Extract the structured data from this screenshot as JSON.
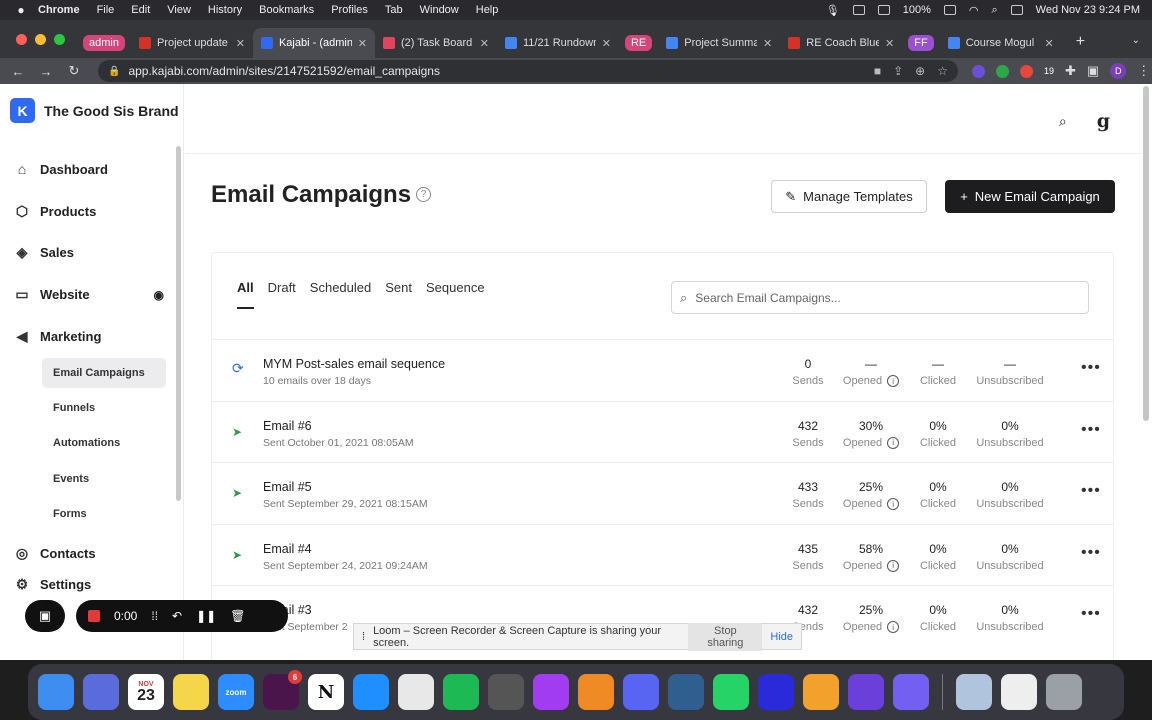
{
  "menubar": {
    "items": [
      "Chrome",
      "File",
      "Edit",
      "View",
      "History",
      "Bookmarks",
      "Profiles",
      "Tab",
      "Window",
      "Help"
    ],
    "battery": "100%",
    "datetime": "Wed Nov 23  9:24 PM"
  },
  "tabs": [
    {
      "label": "admin",
      "kind": "group",
      "color": "#d6457a"
    },
    {
      "label": "Project update",
      "color": "#d93025"
    },
    {
      "label": "Kajabi - (admin)",
      "active": true,
      "color": "#2e6af3"
    },
    {
      "label": "(2) Task Board",
      "color": "#e2445c"
    },
    {
      "label": "11/21 Rundown",
      "color": "#4285f4"
    },
    {
      "label": "RE",
      "kind": "group",
      "color": "#d6457a"
    },
    {
      "label": "Project Summa",
      "color": "#4285f4"
    },
    {
      "label": "RE Coach Blue",
      "color": "#d93025"
    },
    {
      "label": "FF",
      "kind": "group",
      "color": "#9b4fd1"
    },
    {
      "label": "Course Mogul",
      "color": "#4285f4"
    }
  ],
  "address": {
    "url": "app.kajabi.com/admin/sites/2147521592/email_campaigns",
    "profile": "D",
    "ext_badge": "19"
  },
  "brand": {
    "name": "The Good Sis Brand",
    "logo": "K"
  },
  "sidebar": {
    "items": [
      {
        "label": "Dashboard",
        "icon": "home-icon"
      },
      {
        "label": "Products",
        "icon": "box-icon"
      },
      {
        "label": "Sales",
        "icon": "tag-icon"
      },
      {
        "label": "Website",
        "icon": "monitor-icon"
      },
      {
        "label": "Marketing",
        "icon": "megaphone-icon"
      }
    ],
    "sub": [
      "Email Campaigns",
      "Funnels",
      "Automations",
      "Events",
      "Forms"
    ],
    "bottom": [
      {
        "label": "Contacts",
        "icon": "contacts-icon"
      },
      {
        "label": "Settings",
        "icon": "gear-icon"
      }
    ]
  },
  "header": {
    "avatar_letter": "g"
  },
  "main": {
    "title": "Email Campaigns",
    "manage_label": "Manage Templates",
    "new_label": "New Email Campaign",
    "filter_tabs": [
      "All",
      "Draft",
      "Scheduled",
      "Sent",
      "Sequence"
    ],
    "search_placeholder": "Search Email Campaigns...",
    "stat_labels": {
      "sends": "Sends",
      "opened": "Opened",
      "clicked": "Clicked",
      "unsub": "Unsubscribed"
    },
    "rows": [
      {
        "name": "MYM Post-sales email sequence",
        "sub": "10 emails over 18 days",
        "type": "sequence",
        "sends": "0",
        "opened": "—",
        "clicked": "—",
        "unsub": "—"
      },
      {
        "name": "Email #6",
        "sub": "Sent October 01, 2021 08:05AM",
        "type": "sent",
        "sends": "432",
        "opened": "30%",
        "clicked": "0%",
        "unsub": "0%"
      },
      {
        "name": "Email #5",
        "sub": "Sent September 29, 2021 08:15AM",
        "type": "sent",
        "sends": "433",
        "opened": "25%",
        "clicked": "0%",
        "unsub": "0%"
      },
      {
        "name": "Email #4",
        "sub": "Sent September 24, 2021 09:24AM",
        "type": "sent",
        "sends": "435",
        "opened": "58%",
        "clicked": "0%",
        "unsub": "0%"
      },
      {
        "name": "Email #3",
        "sub": "Sent September 2",
        "type": "sent",
        "sends": "432",
        "opened": "25%",
        "clicked": "0%",
        "unsub": "0%"
      }
    ]
  },
  "loom": {
    "timer": "0:00",
    "share_text": "Loom – Screen Recorder & Screen Capture is sharing your screen.",
    "stop_label": "Stop sharing",
    "hide_label": "Hide"
  },
  "dock": {
    "calendar_month": "NOV",
    "calendar_day": "23",
    "zoom_label": "zoom",
    "slack_badge": "6",
    "notion_label": "N",
    "apps": [
      {
        "name": "finder",
        "color": "#3d8ef0"
      },
      {
        "name": "launchpad",
        "color": "#5a6cdb"
      },
      {
        "name": "calendar",
        "color": "#ffffff"
      },
      {
        "name": "notes",
        "color": "#f5d54a"
      },
      {
        "name": "zoom",
        "color": "#2d8cff"
      },
      {
        "name": "slack",
        "color": "#4a154b"
      },
      {
        "name": "notion",
        "color": "#ffffff"
      },
      {
        "name": "safari",
        "color": "#1f8fff"
      },
      {
        "name": "chrome",
        "color": "#e8e8e8"
      },
      {
        "name": "spotify",
        "color": "#1db954"
      },
      {
        "name": "calculator",
        "color": "#555555"
      },
      {
        "name": "messenger",
        "color": "#a23cf0"
      },
      {
        "name": "books",
        "color": "#f08a24"
      },
      {
        "name": "discord",
        "color": "#5865f2"
      },
      {
        "name": "vpn",
        "color": "#2f5f8f"
      },
      {
        "name": "whatsapp",
        "color": "#25d366"
      },
      {
        "name": "podcasts",
        "color": "#2a2adb"
      },
      {
        "name": "garageband",
        "color": "#f2a22c"
      },
      {
        "name": "imovie",
        "color": "#6b3fd9"
      },
      {
        "name": "viber",
        "color": "#7360f2"
      },
      {
        "name": "preview",
        "color": "#b0c4de"
      },
      {
        "name": "document",
        "color": "#eeeeee"
      },
      {
        "name": "trash",
        "color": "#9aa0a6"
      }
    ]
  }
}
